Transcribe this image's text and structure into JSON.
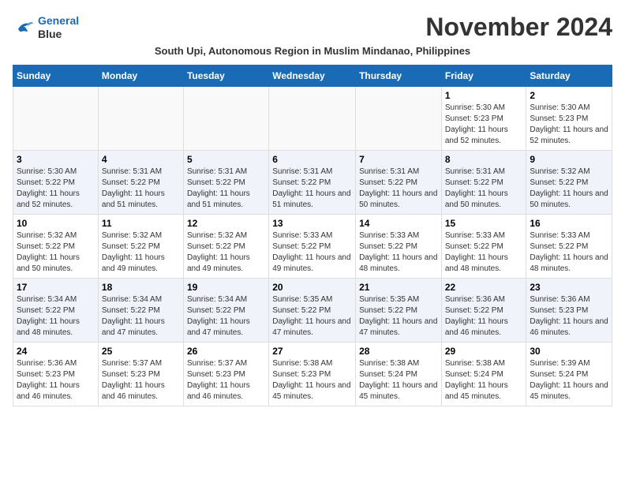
{
  "header": {
    "logo_line1": "General",
    "logo_line2": "Blue",
    "month_title": "November 2024",
    "subtitle": "South Upi, Autonomous Region in Muslim Mindanao, Philippines"
  },
  "weekdays": [
    "Sunday",
    "Monday",
    "Tuesday",
    "Wednesday",
    "Thursday",
    "Friday",
    "Saturday"
  ],
  "weeks": [
    [
      {
        "day": "",
        "info": ""
      },
      {
        "day": "",
        "info": ""
      },
      {
        "day": "",
        "info": ""
      },
      {
        "day": "",
        "info": ""
      },
      {
        "day": "",
        "info": ""
      },
      {
        "day": "1",
        "info": "Sunrise: 5:30 AM\nSunset: 5:23 PM\nDaylight: 11 hours and 52 minutes."
      },
      {
        "day": "2",
        "info": "Sunrise: 5:30 AM\nSunset: 5:23 PM\nDaylight: 11 hours and 52 minutes."
      }
    ],
    [
      {
        "day": "3",
        "info": "Sunrise: 5:30 AM\nSunset: 5:22 PM\nDaylight: 11 hours and 52 minutes."
      },
      {
        "day": "4",
        "info": "Sunrise: 5:31 AM\nSunset: 5:22 PM\nDaylight: 11 hours and 51 minutes."
      },
      {
        "day": "5",
        "info": "Sunrise: 5:31 AM\nSunset: 5:22 PM\nDaylight: 11 hours and 51 minutes."
      },
      {
        "day": "6",
        "info": "Sunrise: 5:31 AM\nSunset: 5:22 PM\nDaylight: 11 hours and 51 minutes."
      },
      {
        "day": "7",
        "info": "Sunrise: 5:31 AM\nSunset: 5:22 PM\nDaylight: 11 hours and 50 minutes."
      },
      {
        "day": "8",
        "info": "Sunrise: 5:31 AM\nSunset: 5:22 PM\nDaylight: 11 hours and 50 minutes."
      },
      {
        "day": "9",
        "info": "Sunrise: 5:32 AM\nSunset: 5:22 PM\nDaylight: 11 hours and 50 minutes."
      }
    ],
    [
      {
        "day": "10",
        "info": "Sunrise: 5:32 AM\nSunset: 5:22 PM\nDaylight: 11 hours and 50 minutes."
      },
      {
        "day": "11",
        "info": "Sunrise: 5:32 AM\nSunset: 5:22 PM\nDaylight: 11 hours and 49 minutes."
      },
      {
        "day": "12",
        "info": "Sunrise: 5:32 AM\nSunset: 5:22 PM\nDaylight: 11 hours and 49 minutes."
      },
      {
        "day": "13",
        "info": "Sunrise: 5:33 AM\nSunset: 5:22 PM\nDaylight: 11 hours and 49 minutes."
      },
      {
        "day": "14",
        "info": "Sunrise: 5:33 AM\nSunset: 5:22 PM\nDaylight: 11 hours and 48 minutes."
      },
      {
        "day": "15",
        "info": "Sunrise: 5:33 AM\nSunset: 5:22 PM\nDaylight: 11 hours and 48 minutes."
      },
      {
        "day": "16",
        "info": "Sunrise: 5:33 AM\nSunset: 5:22 PM\nDaylight: 11 hours and 48 minutes."
      }
    ],
    [
      {
        "day": "17",
        "info": "Sunrise: 5:34 AM\nSunset: 5:22 PM\nDaylight: 11 hours and 48 minutes."
      },
      {
        "day": "18",
        "info": "Sunrise: 5:34 AM\nSunset: 5:22 PM\nDaylight: 11 hours and 47 minutes."
      },
      {
        "day": "19",
        "info": "Sunrise: 5:34 AM\nSunset: 5:22 PM\nDaylight: 11 hours and 47 minutes."
      },
      {
        "day": "20",
        "info": "Sunrise: 5:35 AM\nSunset: 5:22 PM\nDaylight: 11 hours and 47 minutes."
      },
      {
        "day": "21",
        "info": "Sunrise: 5:35 AM\nSunset: 5:22 PM\nDaylight: 11 hours and 47 minutes."
      },
      {
        "day": "22",
        "info": "Sunrise: 5:36 AM\nSunset: 5:22 PM\nDaylight: 11 hours and 46 minutes."
      },
      {
        "day": "23",
        "info": "Sunrise: 5:36 AM\nSunset: 5:23 PM\nDaylight: 11 hours and 46 minutes."
      }
    ],
    [
      {
        "day": "24",
        "info": "Sunrise: 5:36 AM\nSunset: 5:23 PM\nDaylight: 11 hours and 46 minutes."
      },
      {
        "day": "25",
        "info": "Sunrise: 5:37 AM\nSunset: 5:23 PM\nDaylight: 11 hours and 46 minutes."
      },
      {
        "day": "26",
        "info": "Sunrise: 5:37 AM\nSunset: 5:23 PM\nDaylight: 11 hours and 46 minutes."
      },
      {
        "day": "27",
        "info": "Sunrise: 5:38 AM\nSunset: 5:23 PM\nDaylight: 11 hours and 45 minutes."
      },
      {
        "day": "28",
        "info": "Sunrise: 5:38 AM\nSunset: 5:24 PM\nDaylight: 11 hours and 45 minutes."
      },
      {
        "day": "29",
        "info": "Sunrise: 5:38 AM\nSunset: 5:24 PM\nDaylight: 11 hours and 45 minutes."
      },
      {
        "day": "30",
        "info": "Sunrise: 5:39 AM\nSunset: 5:24 PM\nDaylight: 11 hours and 45 minutes."
      }
    ]
  ]
}
